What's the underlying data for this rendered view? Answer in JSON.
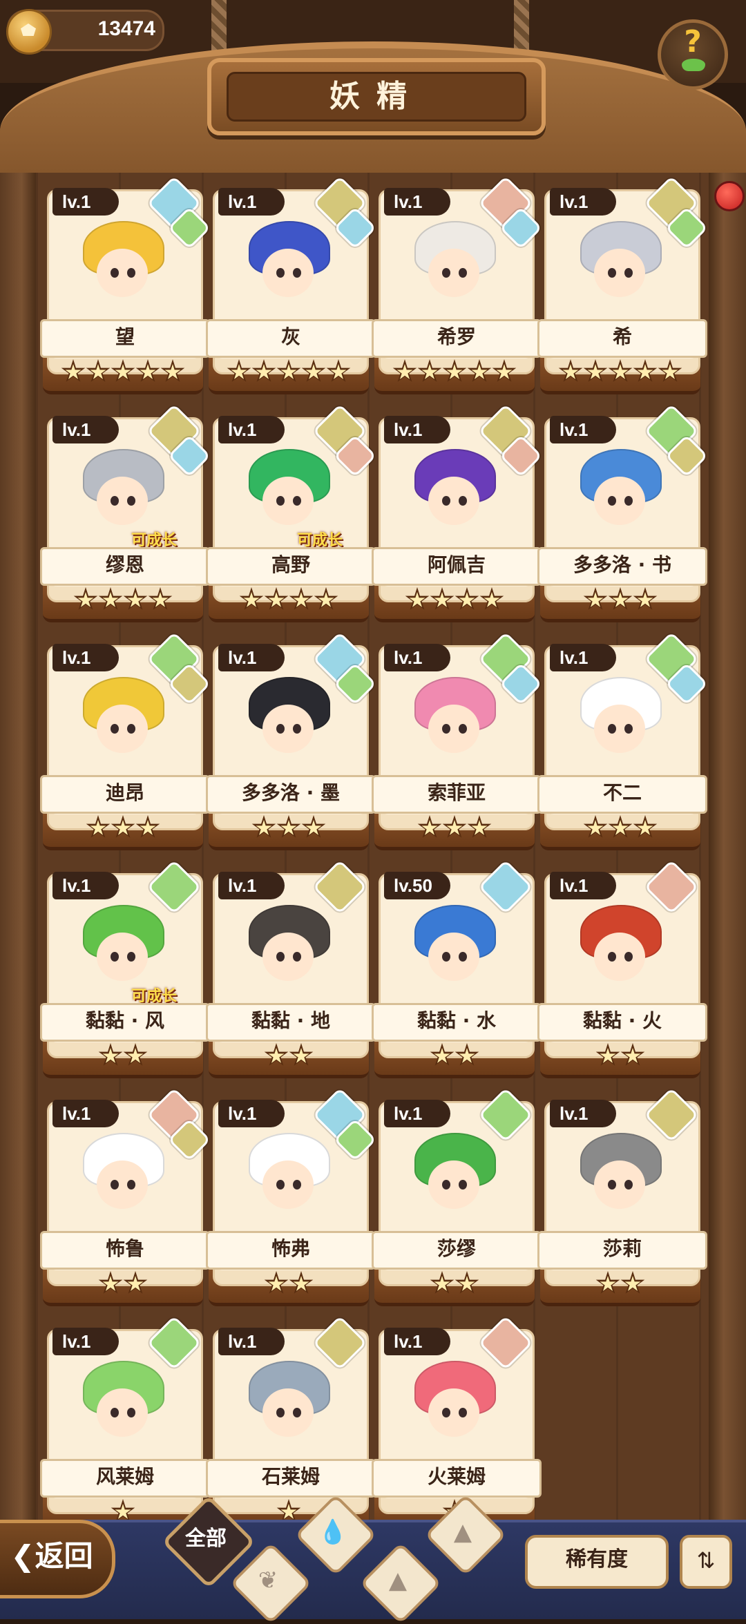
{
  "header": {
    "coins": "13474",
    "title": "妖精",
    "help_symbol": "?"
  },
  "spirits": [
    {
      "level": "lv.1",
      "name": "望",
      "stars": 5,
      "elements": [
        "water",
        "wind"
      ],
      "hair": "#f4c23a",
      "growable": false
    },
    {
      "level": "lv.1",
      "name": "灰",
      "stars": 5,
      "elements": [
        "earth",
        "water"
      ],
      "hair": "#3f56c8",
      "growable": false
    },
    {
      "level": "lv.1",
      "name": "希罗",
      "stars": 5,
      "elements": [
        "fire",
        "water"
      ],
      "hair": "#eeeae4",
      "growable": false
    },
    {
      "level": "lv.1",
      "name": "希",
      "stars": 5,
      "elements": [
        "earth",
        "wind"
      ],
      "hair": "#c9ccd6",
      "growable": false
    },
    {
      "level": "lv.1",
      "name": "缪恩",
      "stars": 4,
      "elements": [
        "earth",
        "water"
      ],
      "hair": "#b8bcc4",
      "growable": true
    },
    {
      "level": "lv.1",
      "name": "高野",
      "stars": 4,
      "elements": [
        "earth",
        "fire"
      ],
      "hair": "#32b660",
      "growable": true
    },
    {
      "level": "lv.1",
      "name": "阿佩吉",
      "stars": 4,
      "elements": [
        "earth",
        "fire"
      ],
      "hair": "#6a3cb8",
      "growable": false
    },
    {
      "level": "lv.1",
      "name": "多多洛 · 书",
      "stars": 3,
      "elements": [
        "wind",
        "earth"
      ],
      "hair": "#4a8ad8",
      "growable": false
    },
    {
      "level": "lv.1",
      "name": "迪昂",
      "stars": 3,
      "elements": [
        "wind",
        "earth"
      ],
      "hair": "#f0c838",
      "growable": false
    },
    {
      "level": "lv.1",
      "name": "多多洛 · 墨",
      "stars": 3,
      "elements": [
        "water",
        "wind"
      ],
      "hair": "#2a2a30",
      "growable": false
    },
    {
      "level": "lv.1",
      "name": "索菲亚",
      "stars": 3,
      "elements": [
        "wind",
        "water"
      ],
      "hair": "#f08ab0",
      "growable": false
    },
    {
      "level": "lv.1",
      "name": "不二",
      "stars": 3,
      "elements": [
        "wind",
        "water"
      ],
      "hair": "#ffffff",
      "growable": false
    },
    {
      "level": "lv.1",
      "name": "黏黏 · 风",
      "stars": 2,
      "elements": [
        "wind"
      ],
      "hair": "#62c24a",
      "growable": true
    },
    {
      "level": "lv.1",
      "name": "黏黏 · 地",
      "stars": 2,
      "elements": [
        "earth"
      ],
      "hair": "#4a4440",
      "growable": false
    },
    {
      "level": "lv.50",
      "name": "黏黏 · 水",
      "stars": 2,
      "elements": [
        "water"
      ],
      "hair": "#3a7ad4",
      "growable": false
    },
    {
      "level": "lv.1",
      "name": "黏黏 · 火",
      "stars": 2,
      "elements": [
        "fire"
      ],
      "hair": "#d0442c",
      "growable": false
    },
    {
      "level": "lv.1",
      "name": "怖鲁",
      "stars": 2,
      "elements": [
        "fire",
        "earth"
      ],
      "hair": "#ffffff",
      "growable": false
    },
    {
      "level": "lv.1",
      "name": "怖弗",
      "stars": 2,
      "elements": [
        "water",
        "wind"
      ],
      "hair": "#ffffff",
      "growable": false
    },
    {
      "level": "lv.1",
      "name": "莎缪",
      "stars": 2,
      "elements": [
        "wind"
      ],
      "hair": "#4ab44a",
      "growable": false
    },
    {
      "level": "lv.1",
      "name": "莎莉",
      "stars": 2,
      "elements": [
        "earth"
      ],
      "hair": "#8a8a8a",
      "growable": false
    },
    {
      "level": "lv.1",
      "name": "风莱姆",
      "stars": 1,
      "elements": [
        "wind"
      ],
      "hair": "#8ad46a",
      "growable": false
    },
    {
      "level": "lv.1",
      "name": "石莱姆",
      "stars": 1,
      "elements": [
        "earth"
      ],
      "hair": "#9aaabb",
      "growable": false
    },
    {
      "level": "lv.1",
      "name": "火莱姆",
      "stars": 1,
      "elements": [
        "fire"
      ],
      "hair": "#f06a7a",
      "growable": false
    }
  ],
  "grow_label": "可成长",
  "footer": {
    "back_label": "返回",
    "filter_all": "全部",
    "filters": [
      {
        "icon": "wind-icon",
        "symbol": "❦"
      },
      {
        "icon": "water-icon",
        "symbol": "💧"
      },
      {
        "icon": "earth-icon",
        "symbol": "▲"
      },
      {
        "icon": "fire-icon",
        "symbol": "▲"
      }
    ],
    "rarity_label": "稀有度",
    "sort_symbol": "⇅"
  },
  "colors": {
    "accent_gold": "#f6c33a",
    "wood": "#7a5232",
    "paper": "#fbefd9",
    "wind": "#9bd67a",
    "water": "#9ad6e6",
    "earth": "#d4c77a",
    "fire": "#e8b4a0"
  }
}
